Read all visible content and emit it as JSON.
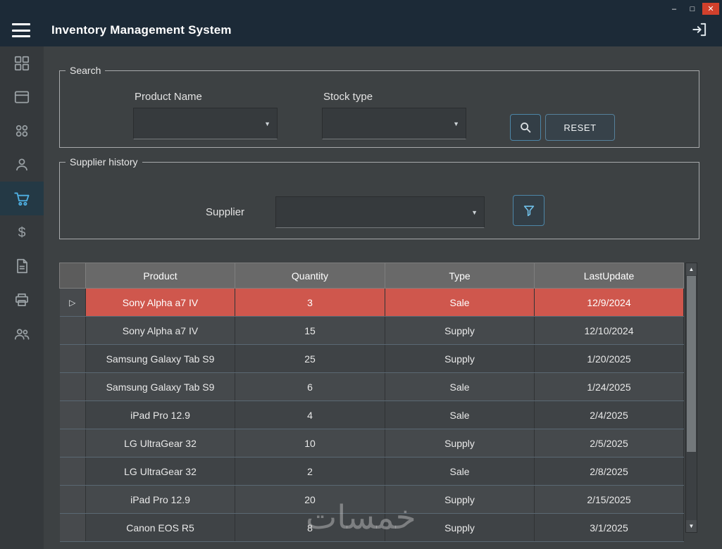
{
  "window": {
    "title": "Inventory Management System",
    "controls": {
      "minimize": "–",
      "maximize": "□",
      "close": "✕"
    }
  },
  "sidebar": {
    "items": [
      {
        "name": "dashboard",
        "icon": "dashboard-icon",
        "selected": false
      },
      {
        "name": "products",
        "icon": "products-icon",
        "selected": false
      },
      {
        "name": "categories",
        "icon": "categories-icon",
        "selected": false
      },
      {
        "name": "suppliers",
        "icon": "person-icon",
        "selected": false
      },
      {
        "name": "purchases",
        "icon": "shopping-cart-icon",
        "selected": true
      },
      {
        "name": "sales",
        "icon": "dollar-icon",
        "selected": false
      },
      {
        "name": "invoices",
        "icon": "document-icon",
        "selected": false
      },
      {
        "name": "print",
        "icon": "printer-icon",
        "selected": false
      },
      {
        "name": "users",
        "icon": "users-icon",
        "selected": false
      }
    ]
  },
  "search_panel": {
    "title": "Search",
    "product_name_label": "Product Name",
    "product_name_value": "",
    "stock_type_label": "Stock type",
    "stock_type_value": "",
    "reset_label": "RESET"
  },
  "supplier_panel": {
    "title": "Supplier history",
    "supplier_label": "Supplier",
    "supplier_value": ""
  },
  "table": {
    "columns": [
      "Product",
      "Quantity",
      "Type",
      "LastUpdate"
    ],
    "selection_marker": "▷",
    "rows": [
      {
        "product": "Sony Alpha a7 IV",
        "quantity": 3,
        "type": "Sale",
        "last_update": "12/9/2024",
        "selected": true
      },
      {
        "product": "Sony Alpha a7 IV",
        "quantity": 15,
        "type": "Supply",
        "last_update": "12/10/2024",
        "selected": false
      },
      {
        "product": "Samsung Galaxy Tab S9",
        "quantity": 25,
        "type": "Supply",
        "last_update": "1/20/2025",
        "selected": false
      },
      {
        "product": "Samsung Galaxy Tab S9",
        "quantity": 6,
        "type": "Sale",
        "last_update": "1/24/2025",
        "selected": false
      },
      {
        "product": "iPad Pro 12.9",
        "quantity": 4,
        "type": "Sale",
        "last_update": "2/4/2025",
        "selected": false
      },
      {
        "product": "LG UltraGear 32",
        "quantity": 10,
        "type": "Supply",
        "last_update": "2/5/2025",
        "selected": false
      },
      {
        "product": "LG UltraGear 32",
        "quantity": 2,
        "type": "Sale",
        "last_update": "2/8/2025",
        "selected": false
      },
      {
        "product": "iPad Pro 12.9",
        "quantity": 20,
        "type": "Supply",
        "last_update": "2/15/2025",
        "selected": false
      },
      {
        "product": "Canon EOS R5",
        "quantity": 8,
        "type": "Supply",
        "last_update": "3/1/2025",
        "selected": false
      }
    ]
  },
  "icons": {
    "dropdown_arrow": "▼",
    "scroll_up": "▲",
    "scroll_down": "▼"
  },
  "watermark": {
    "text": "خمسات"
  },
  "colors": {
    "titlebar": "#1c2a37",
    "sidebar": "#35393c",
    "background": "#3d4143",
    "accent": "#4fb0e3",
    "selected_row": "#cf574d",
    "table_header": "#696969"
  }
}
